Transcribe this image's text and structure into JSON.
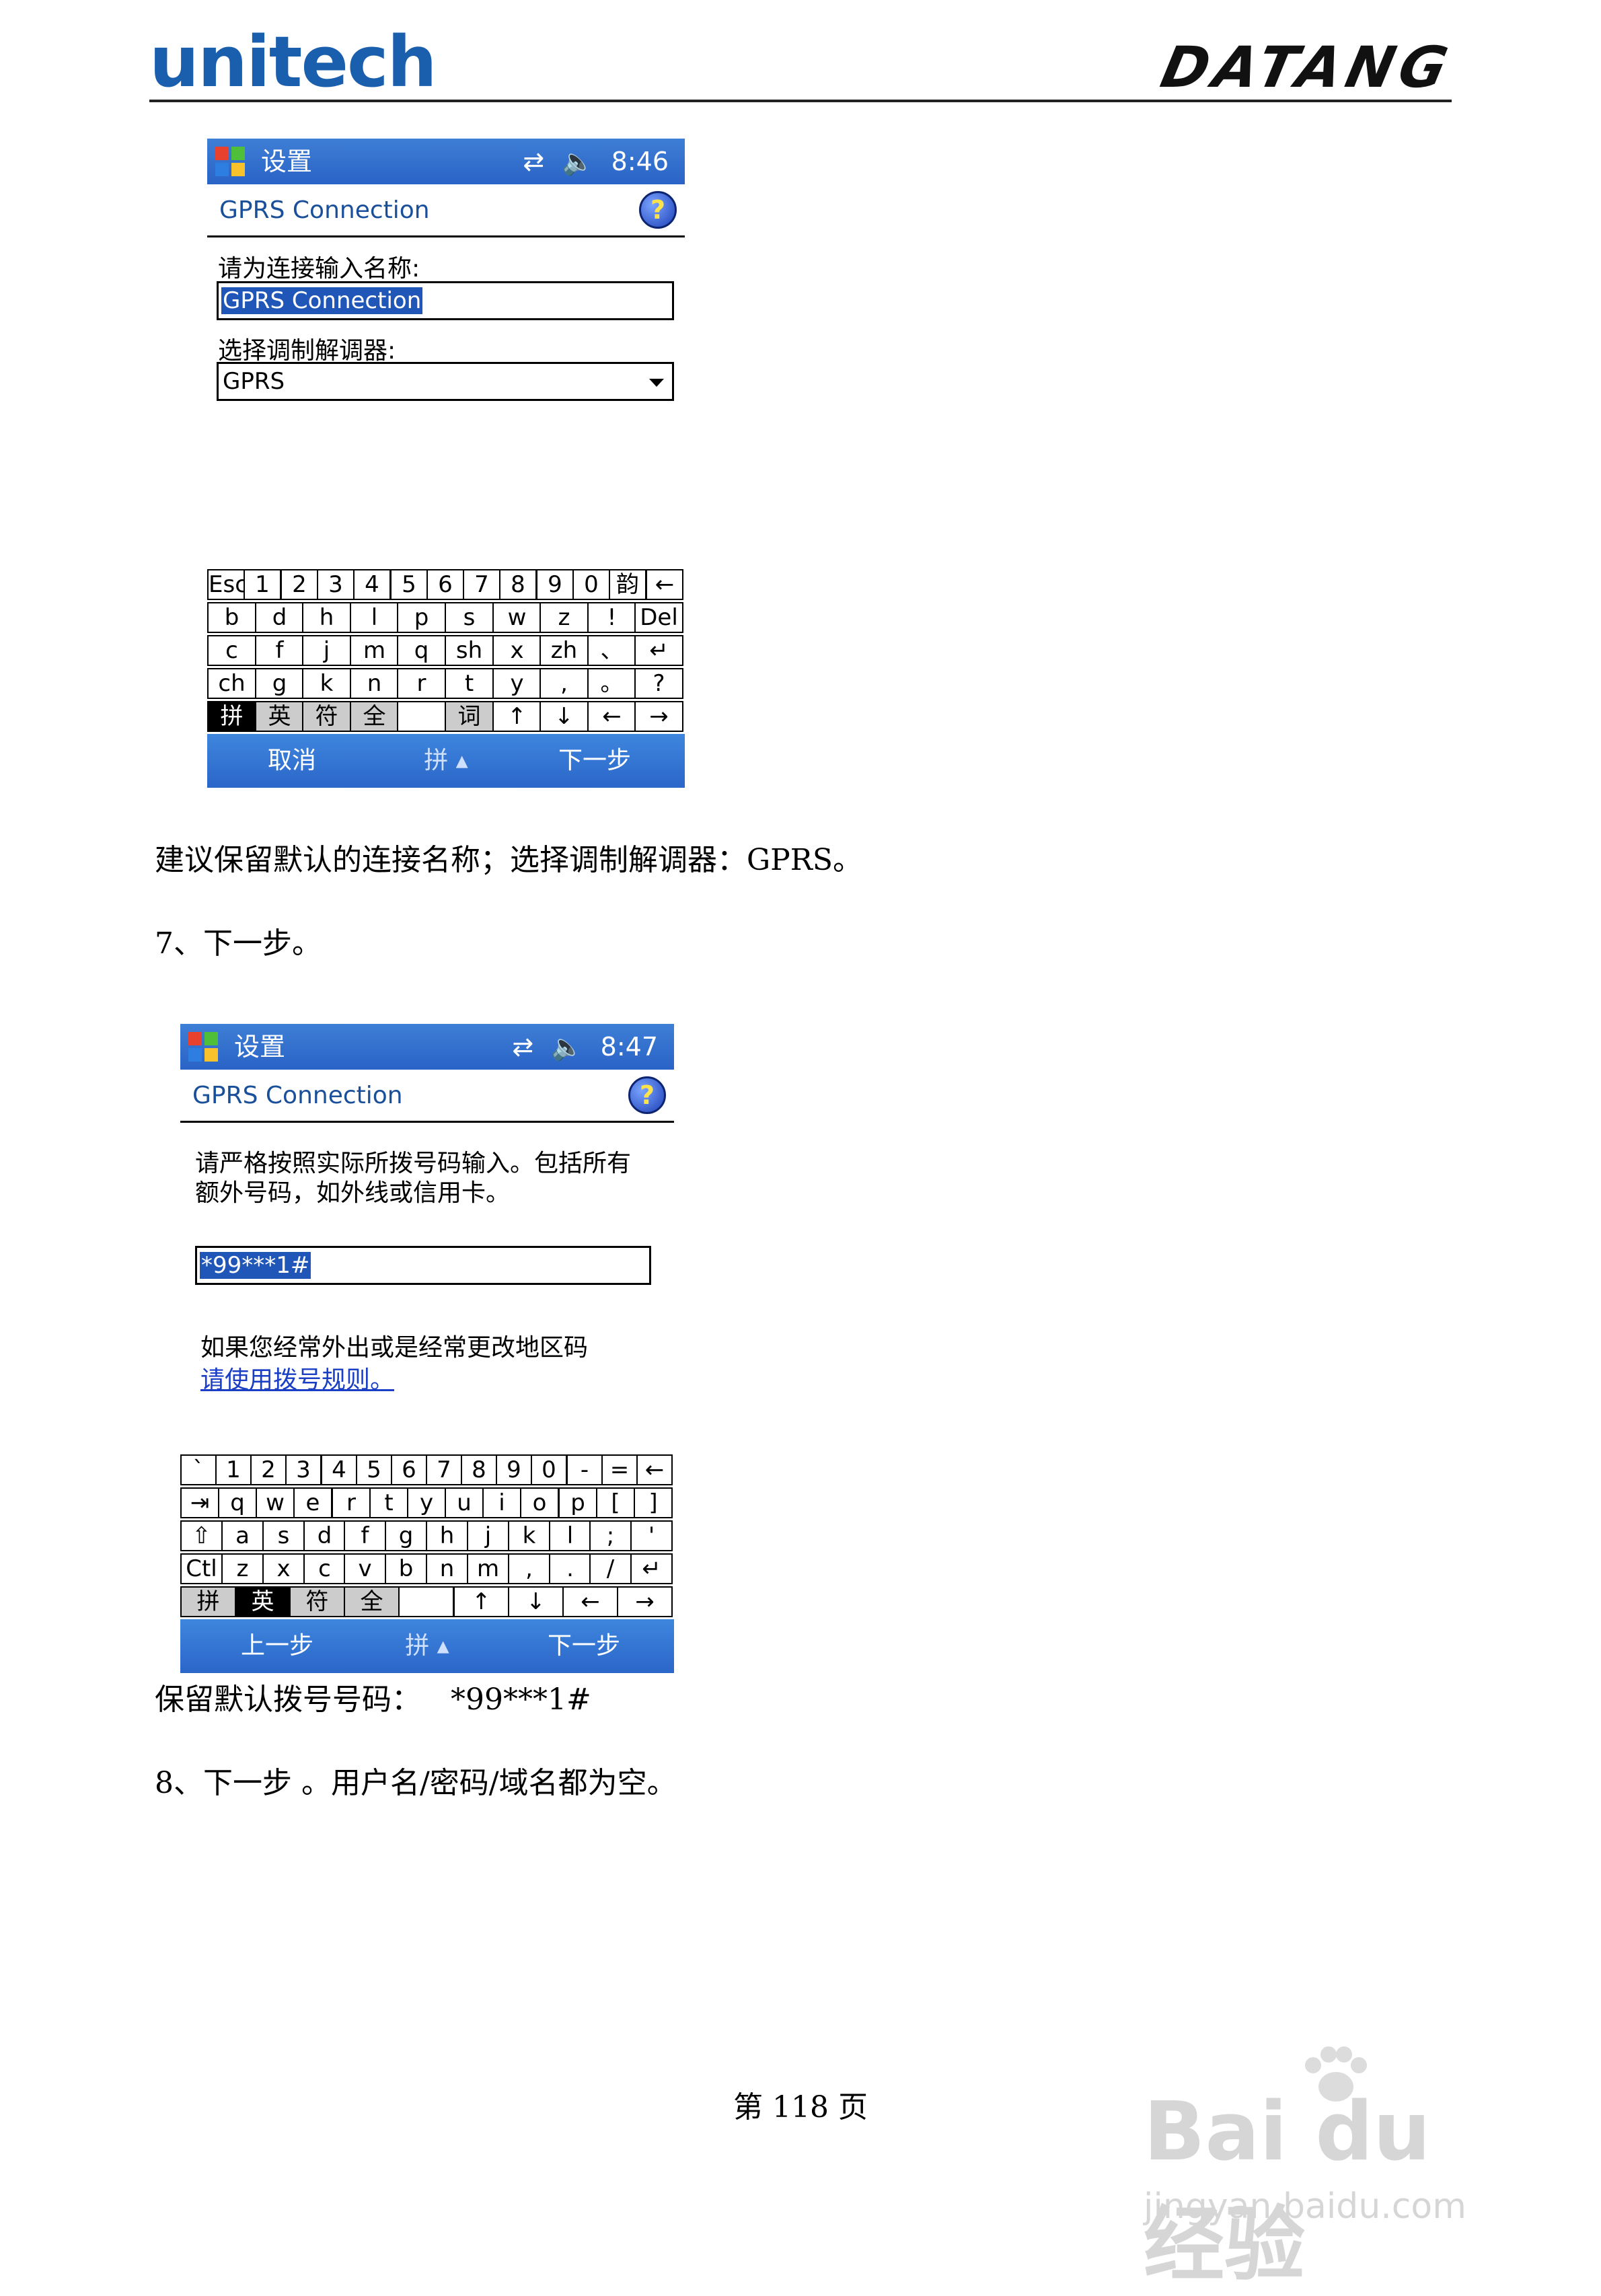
{
  "header": {
    "brand_left": "unitech",
    "brand_right": "DATANG"
  },
  "screen1": {
    "title": "设置",
    "status_icons": [
      "connection-icon",
      "speaker-icon"
    ],
    "time": "8:46",
    "subheader": "GPRS Connection",
    "name_label": "请为连接输入名称:",
    "name_value": "GPRS Connection",
    "modem_label": "选择调制解调器:",
    "modem_value": "GPRS",
    "keyboard": [
      [
        "Esc",
        "1",
        "2",
        "3",
        "4",
        "5",
        "6",
        "7",
        "8",
        "9",
        "0",
        "韵",
        "←"
      ],
      [
        "b",
        "d",
        "h",
        "l",
        "p",
        "s",
        "w",
        "z",
        "!",
        "Del"
      ],
      [
        "c",
        "f",
        "j",
        "m",
        "q",
        "sh",
        "x",
        "zh",
        "、",
        "↵"
      ],
      [
        "ch",
        "g",
        "k",
        "n",
        "r",
        "t",
        "y",
        ",",
        "。",
        "?"
      ],
      [
        "拼",
        "英",
        "符",
        "全",
        "",
        "词",
        "↑",
        "↓",
        "←",
        "→"
      ]
    ],
    "menu_left": "取消",
    "menu_mid": "拼 ▴",
    "menu_right": "下一步"
  },
  "para1": "建议保留默认的连接名称；选择调制解调器：GPRS。",
  "step7": "7、下一步。",
  "screen2": {
    "title": "设置",
    "status_icons": [
      "connection-icon",
      "speaker-icon"
    ],
    "time": "8:47",
    "subheader": "GPRS Connection",
    "instruction_line1": "请严格按照实际所拨号码输入。包括所有",
    "instruction_line2": "额外号码，如外线或信用卡。",
    "dial_value": "*99***1#",
    "hint_text": "如果您经常外出或是经常更改地区码",
    "hint_link": "请使用拨号规则。",
    "keyboard": [
      [
        "`",
        "1",
        "2",
        "3",
        "4",
        "5",
        "6",
        "7",
        "8",
        "9",
        "0",
        "-",
        "=",
        "←"
      ],
      [
        "⇥",
        "q",
        "w",
        "e",
        "r",
        "t",
        "y",
        "u",
        "i",
        "o",
        "p",
        "[",
        "]"
      ],
      [
        "⇧",
        "a",
        "s",
        "d",
        "f",
        "g",
        "h",
        "j",
        "k",
        "l",
        ";",
        "'"
      ],
      [
        "Ctl",
        "z",
        "x",
        "c",
        "v",
        "b",
        "n",
        "m",
        ",",
        ".",
        "/",
        "↵"
      ],
      [
        "拼",
        "英",
        "符",
        "全",
        "",
        "↑",
        "↓",
        "←",
        "→"
      ]
    ],
    "menu_left": "上一步",
    "menu_mid": "拼 ▴",
    "menu_right": "下一步"
  },
  "para2_label": "保留默认拨号号码：",
  "para2_value": "*99***1#",
  "step8": "8、下一步 。用户名/密码/域名都为空。",
  "footer": "第 118 页",
  "watermark": {
    "main": "Bai du 经验",
    "url": "jingyan.baidu.com"
  },
  "colors": {
    "titlebar": "#2a63c6",
    "menubar": "#2b66c9",
    "brand": "#1a5fae",
    "link": "#1a3fc4"
  }
}
